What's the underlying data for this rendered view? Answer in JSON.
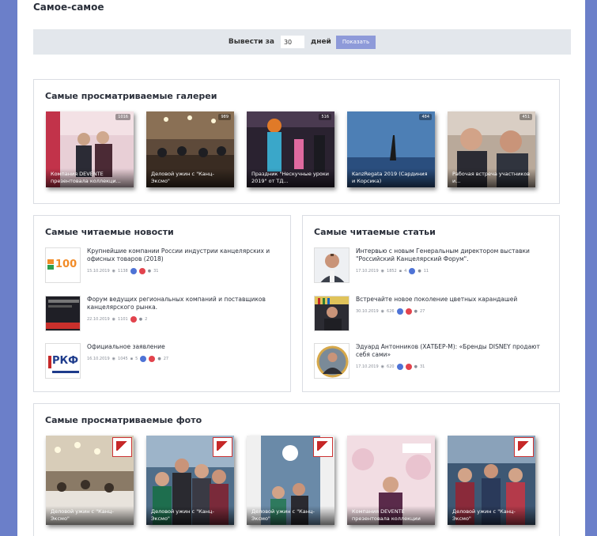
{
  "page": {
    "title": "Самое-самое"
  },
  "filter": {
    "label_prefix": "Вывести за",
    "days_value": "30",
    "label_suffix": "дней",
    "button_label": "Показать"
  },
  "galleries": {
    "title": "Самые просматриваемые галереи",
    "items": [
      {
        "views": "1016",
        "caption": "Компания DEVENTE презентовала коллекци..."
      },
      {
        "views": "989",
        "caption": "Деловой ужин с \"Канц-Эксмо\""
      },
      {
        "views": "516",
        "caption": "Праздник \"Нескучные уроки 2019\" от ТД..."
      },
      {
        "views": "484",
        "caption": "KanzRegata 2019 (Сардиния и Корсика)"
      },
      {
        "views": "451",
        "caption": "Рабочая встреча участников и..."
      }
    ]
  },
  "news": {
    "title": "Самые читаемые новости",
    "items": [
      {
        "title": "Крупнейшие компании России индустрии канцелярских и офисных товаров (2018)",
        "date": "15.10.2019",
        "views": "1138",
        "likes": "31"
      },
      {
        "title": "Форум ведущих региональных компаний и поставщиков канцелярского рынка.",
        "date": "22.10.2019",
        "views": "1101",
        "likes": "2"
      },
      {
        "title": "Официальное заявление",
        "date": "16.10.2019",
        "views": "1045",
        "comments": "5",
        "likes": "27"
      }
    ]
  },
  "articles": {
    "title": "Самые читаемые статьи",
    "items": [
      {
        "title": "Интервью с новым Генеральным директором выставки \"Российский Канцелярский Форум\".",
        "date": "17.10.2019",
        "views": "1852",
        "comments": "4",
        "likes": "11"
      },
      {
        "title": "Встречайте новое поколение цветных карандашей",
        "date": "30.10.2019",
        "views": "626",
        "likes": "27"
      },
      {
        "title": "Эдуард Антонников (ХАТБЕР-М): «Бренды DISNEY продают себя сами»",
        "date": "17.10.2019",
        "views": "620",
        "likes": "31"
      }
    ]
  },
  "photos": {
    "title": "Самые просматриваемые фото",
    "items": [
      {
        "caption": "Деловой ужин с \"Канц-Эксмо\""
      },
      {
        "caption": "Деловой ужин с \"Канц-Эксмо\""
      },
      {
        "caption": "Деловой ужин с \"Канц-Эксмо\""
      },
      {
        "caption": "Компания DEVENTE презентовала коллекции"
      },
      {
        "caption": "Деловой ужин с \"Канц-Эксмо\""
      }
    ]
  },
  "news_thumb_texts": {
    "rkf": "РКФ",
    "hundred": "100"
  },
  "colors": {
    "background": "#6b7fc9",
    "accent_button": "#8e9ad9",
    "filter_bg": "#e3e7ec"
  }
}
